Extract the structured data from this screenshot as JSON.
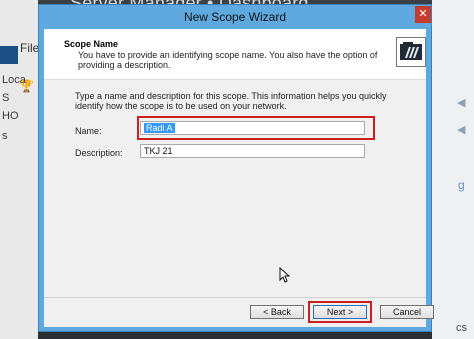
{
  "background": {
    "app_title": "Server Manager • Dashboard",
    "left_menu_file": "File",
    "left_labels": [
      "Loca",
      "S",
      "HO",
      "s"
    ],
    "right_labels": [
      "g",
      "cs"
    ]
  },
  "window": {
    "title": "New Scope Wizard",
    "close_glyph": "✕"
  },
  "header": {
    "title": "Scope Name",
    "description": "You have to provide an identifying scope name. You also have the option of providing a description.",
    "icon": "folder-icon"
  },
  "body": {
    "intro": "Type a name and description for this scope. This information helps you quickly identify how the scope is to be used on your network.",
    "name_label": "Name:",
    "name_value": "Radi A",
    "description_label": "Description:",
    "description_value": "TKJ 21"
  },
  "buttons": {
    "back": "< Back",
    "next": "Next >",
    "cancel": "Cancel"
  },
  "colors": {
    "title_bar": "#5ea9e0",
    "highlight": "#cc1e1e",
    "selection": "#3399ff"
  }
}
